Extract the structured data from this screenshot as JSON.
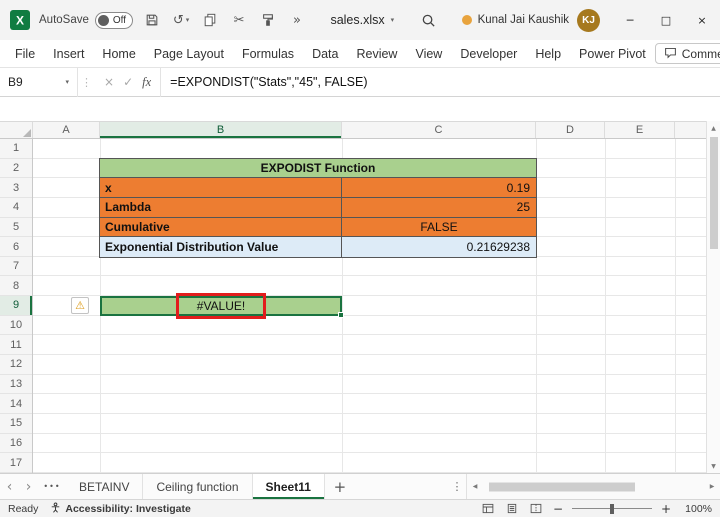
{
  "colors": {
    "excel_brand_green": "#107c41",
    "selection_green": "#1a7340",
    "table_green": "#a9d08e",
    "table_orange": "#ed7d31",
    "table_blue": "#ddebf7",
    "annotation_red": "#e21d1d",
    "avatar_gold": "#a6791e"
  },
  "icons": {
    "undo": "↺",
    "cut": "✂",
    "overflow": "»",
    "dropdown": "▾",
    "cancel": "×",
    "enter": "✓",
    "minimize": "─",
    "maximize": "□",
    "close": "×",
    "warning": "⚠",
    "vertical_dots": "⋮",
    "more_sheets": "•••",
    "nav_left": "‹",
    "nav_right": "›",
    "add_sheet": "+",
    "scroll_up": "▲",
    "scroll_down": "▼",
    "scroll_left": "◀",
    "scroll_right": "▶",
    "zoom_out": "−",
    "zoom_in": "+"
  },
  "title_bar": {
    "autosave_label": "AutoSave",
    "autosave_state": "Off",
    "filename": "sales.xlsx",
    "user_name": "Kunal Jai Kaushik",
    "user_initials": "KJ"
  },
  "ribbon": {
    "tabs": [
      "File",
      "Insert",
      "Home",
      "Page Layout",
      "Formulas",
      "Data",
      "Review",
      "View",
      "Developer",
      "Help",
      "Power Pivot"
    ],
    "comments_label": "Comments"
  },
  "formula_bar": {
    "name_box_value": "B9",
    "fx_label": "fx",
    "formula": "=EXPONDIST(\"Stats\",\"45\", FALSE)"
  },
  "grid": {
    "column_headers": [
      "A",
      "B",
      "C",
      "D",
      "E"
    ],
    "row_numbers": [
      "1",
      "2",
      "3",
      "4",
      "5",
      "6",
      "7",
      "8",
      "9",
      "10",
      "11",
      "12",
      "13",
      "14",
      "15",
      "16",
      "17"
    ],
    "selected_cell": "B9",
    "selected_column": "B",
    "selected_row": "9",
    "table": {
      "title": "EXPODIST Function",
      "rows": [
        {
          "label": "x",
          "value": "0.19"
        },
        {
          "label": "Lambda",
          "value": "25"
        },
        {
          "label": "Cumulative",
          "value": "FALSE"
        },
        {
          "label": "Exponential Distribution Value",
          "value": "0.21629238"
        }
      ]
    },
    "error_cell": {
      "ref": "B9",
      "value": "#VALUE!"
    }
  },
  "sheet_bar": {
    "tabs": [
      {
        "label": "BETAINV",
        "active": false
      },
      {
        "label": "Ceiling function",
        "active": false
      },
      {
        "label": "Sheet11",
        "active": true
      }
    ]
  },
  "status_bar": {
    "mode": "Ready",
    "accessibility": "Accessibility: Investigate",
    "zoom_level": "100%"
  }
}
